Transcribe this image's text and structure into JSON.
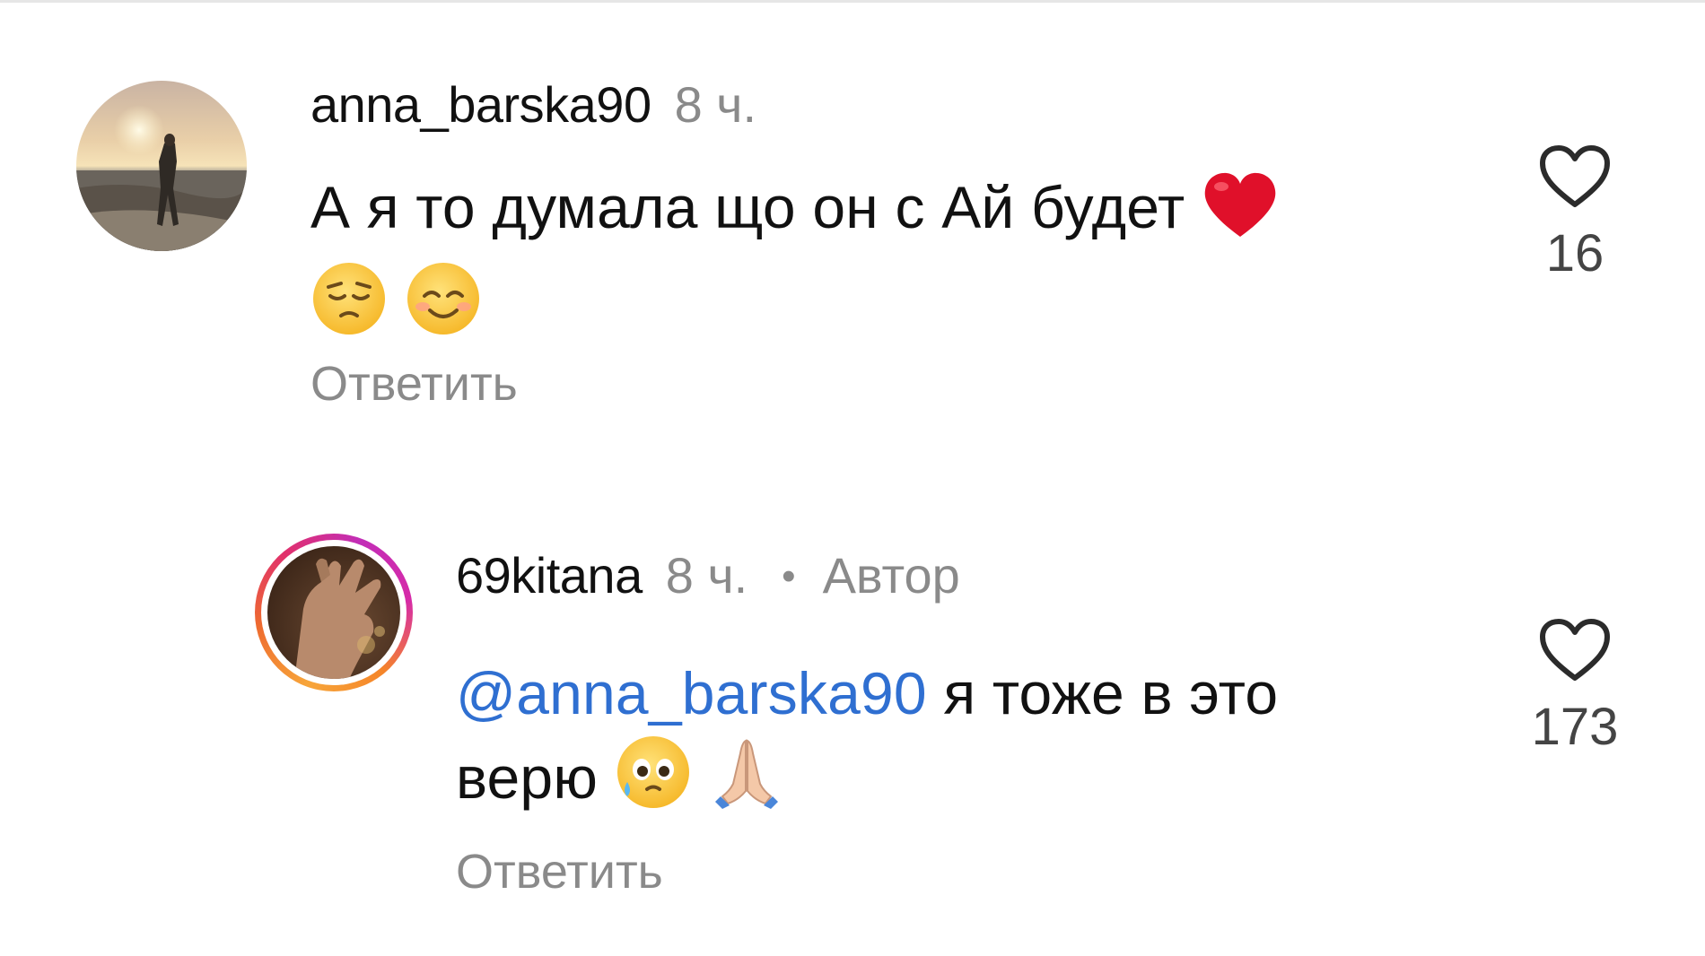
{
  "comments": [
    {
      "username": "anna_barska90",
      "time": "8 ч.",
      "text": "А я  то думала що он с Ай будет",
      "emojis": [
        "heart",
        "pensive-face",
        "smiling-face"
      ],
      "reply_label": "Ответить",
      "likes": "16"
    },
    {
      "username": "69kitana",
      "time": "8 ч.",
      "separator": "•",
      "author_badge": "Автор",
      "mention": "@anna_barska90",
      "text_line1": " я тоже в это",
      "text_line2": "верю",
      "emojis": [
        "face-holding-back-tears",
        "folded-hands"
      ],
      "reply_label": "Ответить",
      "likes": "173"
    }
  ],
  "colors": {
    "mention": "#2f6fd1",
    "secondary_text": "#8a8a8a",
    "heart_emoji": "#e0102a"
  }
}
